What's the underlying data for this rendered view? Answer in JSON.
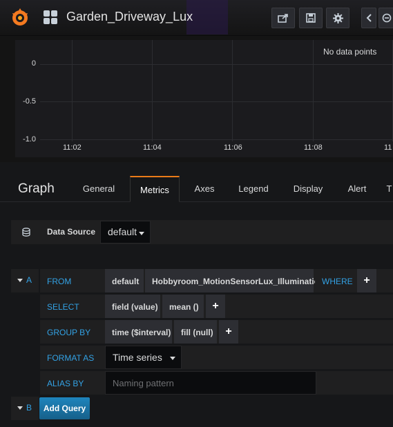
{
  "navbar": {
    "title": "Garden_Driveway_Lux",
    "icons": [
      "grafana-logo-icon",
      "dashboard-grid-icon",
      "share-icon",
      "save-icon",
      "settings-icon",
      "time-back-icon",
      "zoom-out-icon"
    ]
  },
  "panel": {
    "no_data": "No data points",
    "y_ticks": [
      "0",
      "-0.5",
      "-1.0"
    ],
    "x_ticks": [
      "11:02",
      "11:04",
      "11:06",
      "11:08",
      "11"
    ]
  },
  "editor": {
    "panel_type": "Graph",
    "tabs": [
      "General",
      "Metrics",
      "Axes",
      "Legend",
      "Display",
      "Alert",
      "T"
    ],
    "active_tab": "Metrics"
  },
  "datasource": {
    "label": "Data Source",
    "value": "default"
  },
  "query_a": {
    "letter": "A",
    "from_label": "FROM",
    "from_policy": "default",
    "measurement": "Hobbyroom_MotionSensorLux_Illumination",
    "where_label": "WHERE",
    "select_label": "SELECT",
    "select_field": "field (value)",
    "select_fn": "mean ()",
    "group_label": "GROUP BY",
    "group_time": "time ($interval)",
    "group_fill": "fill (null)",
    "format_label": "FORMAT AS",
    "format_value": "Time series",
    "alias_label": "ALIAS BY",
    "alias_placeholder": "Naming pattern",
    "plus": "+"
  },
  "query_b": {
    "letter": "B",
    "add_label": "Add Query"
  },
  "colors": {
    "accent_blue": "#33a2e5",
    "tab_active": "#eb7b18",
    "button_blue": "#1e85bd"
  }
}
